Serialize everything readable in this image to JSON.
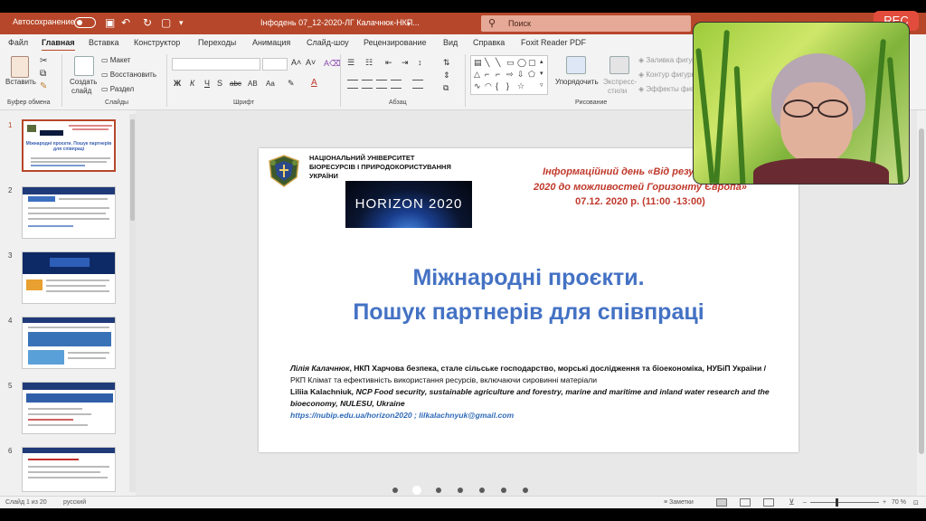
{
  "titlebar": {
    "autosave_label": "Автосохранение",
    "doc_title": "Інфодень 07_12-2020-ЛГ Калачнюк-НКП...",
    "search_placeholder": "Поиск",
    "accent_color": "#b7472a"
  },
  "recording": {
    "label": "REC"
  },
  "menu": {
    "tabs": [
      "Файл",
      "Главная",
      "Вставка",
      "Конструктор",
      "Переходы",
      "Анимация",
      "Слайд-шоу",
      "Рецензирование",
      "Вид",
      "Справка",
      "Foxit Reader PDF"
    ],
    "active_tab": "Главная"
  },
  "ribbon": {
    "clipboard": {
      "paste": "Вставить",
      "group": "Буфер обмена"
    },
    "slides": {
      "create": "Создать",
      "create2": "слайд",
      "layout": "Макет",
      "reset": "Восстановить",
      "section": "Раздел",
      "group": "Слайды"
    },
    "font": {
      "group": "Шрифт",
      "bold": "Ж",
      "italic": "К",
      "underline": "Ч",
      "strike": "S",
      "shadow": "abc",
      "spacing": "АВ",
      "case": "Аа"
    },
    "paragraph": {
      "group": "Абзац"
    },
    "drawing": {
      "arrange": "Упорядочить",
      "quick_styles_1": "Экспресс-",
      "quick_styles_2": "стили",
      "fill": "Заливка фигуры",
      "outline": "Контур фигуры",
      "effects": "Эффекты фигуры",
      "group": "Рисование"
    }
  },
  "thumbnails": [
    {
      "num": "1",
      "title": "Міжнародні проєкти. Пошук партнерів для співпраці"
    },
    {
      "num": "2"
    },
    {
      "num": "3"
    },
    {
      "num": "4"
    },
    {
      "num": "5"
    },
    {
      "num": "6"
    }
  ],
  "slide": {
    "university_line1": "НАЦІОНАЛЬНИЙ УНІВЕРСИТЕТ",
    "university_line2": "БІОРЕСУРСІВ І ПРИРОДОКОРИСТУВАННЯ",
    "university_line3": "УКРАЇНИ",
    "horizon_logo": "HORIZON 2020",
    "info_line1": "Інформаційний день «Від результатів",
    "info_line2": "2020 до можливостей Горизонту Європа»",
    "datetime": "07.12. 2020 р. (11:00 -13:00)",
    "title_line1": "Міжнародні проєкти.",
    "title_line2": "Пошук партнерів для співпраці",
    "author_name": "Лілія Калачнюк",
    "author_role": ", НКП Харчова безпека, сталe сільське господарство, морські дослідження та біоекономіка,",
    "author_org": "НУБіП України /",
    "author_role2": " РКП Клімат та ефективність використання ресурсів, включаючи сировинні матеріали",
    "author_name_en": "Liliia Kalachniuk",
    "author_role_en": ", NCP Food security, sustainable agriculture and forestry, marine and maritime and inland water research and the bioeconomy, NULESU, Ukraine",
    "links": "https://nubip.edu.ua/horizon2020 ; lilkalachnyuk@gmail.com",
    "title_color": "#4472c4",
    "accent_red": "#c0392b"
  },
  "statusbar": {
    "slide_info": "Слайд 1 из 20",
    "language": "русский",
    "notes": "Заметки",
    "zoom": "70 %"
  }
}
